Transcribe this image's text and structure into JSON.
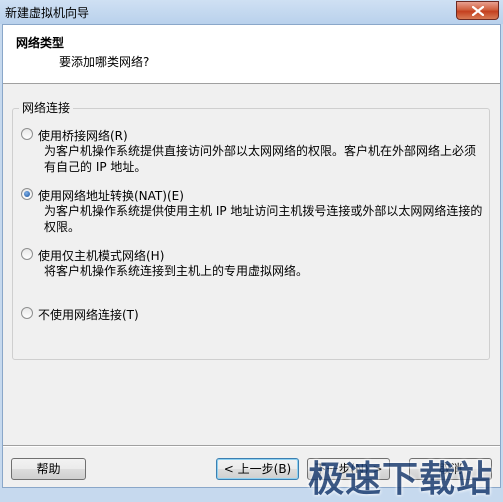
{
  "window": {
    "title": "新建虚拟机向导"
  },
  "header": {
    "title": "网络类型",
    "subtitle": "要添加哪类网络?"
  },
  "group": {
    "legend": "网络连接"
  },
  "options": [
    {
      "label": "使用桥接网络(R)",
      "description": "为客户机操作系统提供直接访问外部以太网网络的权限。客户机在外部网络上必须有自己的 IP 地址。",
      "selected": false
    },
    {
      "label": "使用网络地址转换(NAT)(E)",
      "description": "为客户机操作系统提供使用主机 IP 地址访问主机拨号连接或外部以太网网络连接的权限。",
      "selected": true
    },
    {
      "label": "使用仅主机模式网络(H)",
      "description": "将客户机操作系统连接到主机上的专用虚拟网络。",
      "selected": false
    },
    {
      "label": "不使用网络连接(T)",
      "description": "",
      "selected": false
    }
  ],
  "buttons": {
    "help": "帮助",
    "back": "< 上一步(B)",
    "next": "下一步(N) >",
    "cancel": "取消"
  },
  "watermark": "极速下载站",
  "icons": {
    "close": "close-icon",
    "radio": "radio-icon"
  }
}
